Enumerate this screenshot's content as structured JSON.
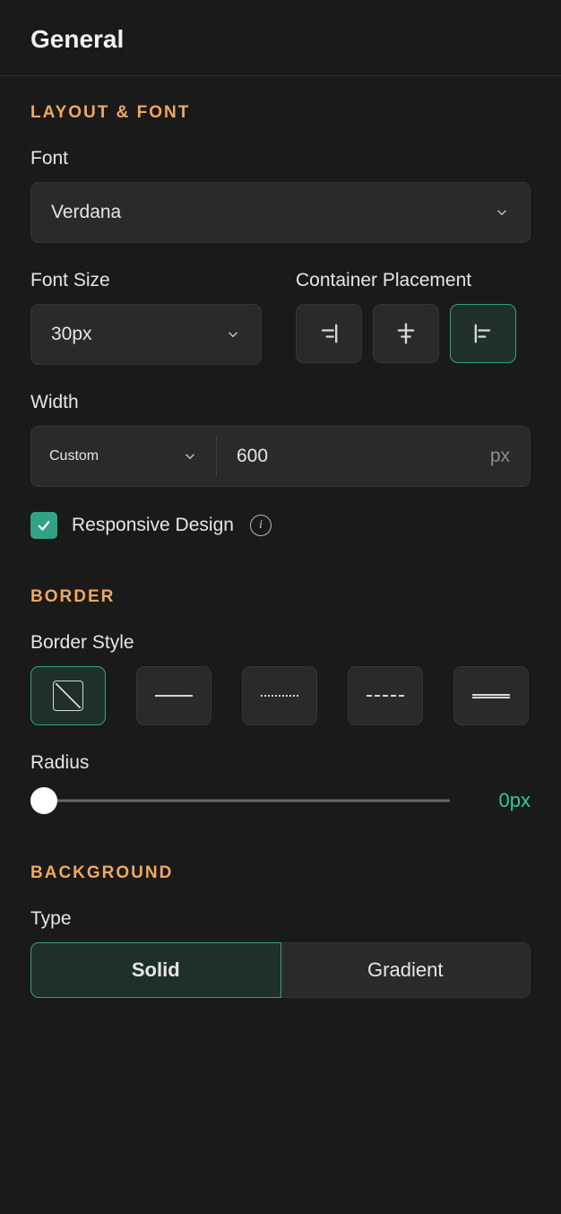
{
  "header": {
    "title": "General"
  },
  "layout": {
    "section_title": "LAYOUT & FONT",
    "font_label": "Font",
    "font_value": "Verdana",
    "fontsize_label": "Font Size",
    "fontsize_value": "30px",
    "placement_label": "Container Placement",
    "placement_selected": "left",
    "width_label": "Width",
    "width_mode": "Custom",
    "width_value": "600",
    "width_unit": "px",
    "responsive_label": "Responsive Design",
    "responsive_checked": true
  },
  "border": {
    "section_title": "BORDER",
    "style_label": "Border Style",
    "style_selected": "none",
    "radius_label": "Radius",
    "radius_value": "0px"
  },
  "background": {
    "section_title": "BACKGROUND",
    "type_label": "Type",
    "type_options": {
      "solid": "Solid",
      "gradient": "Gradient"
    },
    "type_selected": "solid"
  }
}
